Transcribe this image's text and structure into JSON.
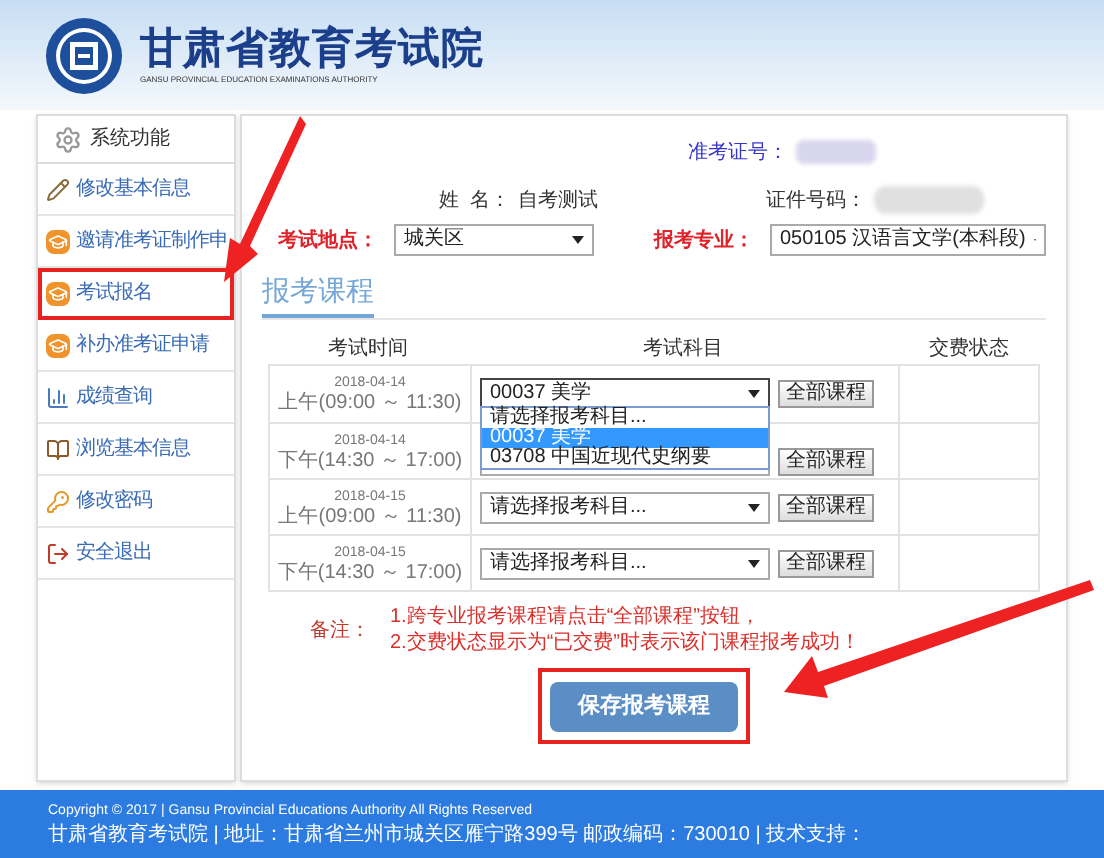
{
  "header": {
    "title": "甘肃省教育考试院",
    "subtitle": "GANSU PROVINCIAL EDUCATION EXAMINATIONS AUTHORITY"
  },
  "sidebar": {
    "title": "系统功能",
    "items": [
      {
        "label": "修改基本信息",
        "highlighted": false
      },
      {
        "label": "邀请准考证制作申",
        "highlighted": false
      },
      {
        "label": "考试报名",
        "highlighted": true
      },
      {
        "label": "补办准考证申请",
        "highlighted": false
      },
      {
        "label": "成绩查询",
        "highlighted": false
      },
      {
        "label": "浏览基本信息",
        "highlighted": false
      },
      {
        "label": "修改密码",
        "highlighted": false
      },
      {
        "label": "安全退出",
        "highlighted": false
      }
    ]
  },
  "ticket_label": "准考证号：",
  "name_label": "姓  名：",
  "name_value": "自考测试",
  "id_label": "证件号码：",
  "location": {
    "label": "考试地点：",
    "value": "城关区"
  },
  "major": {
    "label": "报考专业：",
    "value": "050105 汉语言文学(本科段)"
  },
  "section_title": "报考课程",
  "table": {
    "columns": [
      "考试时间",
      "考试科目",
      "交费状态"
    ],
    "rows": [
      {
        "date": "2018-04-14",
        "time": "上午(09:00 ～ 11:30)",
        "subject": "00037 美学",
        "button": "全部课程",
        "expanded": true,
        "options": [
          {
            "label": "请选择报考科目...",
            "selected": false
          },
          {
            "label": "00037 美学",
            "selected": true
          },
          {
            "label": "03708 中国近现代史纲要",
            "selected": false
          }
        ]
      },
      {
        "date": "2018-04-14",
        "time": "下午(14:30 ～ 17:00)",
        "subject": "",
        "button": "全部课程",
        "expanded": false
      },
      {
        "date": "2018-04-15",
        "time": "上午(09:00 ～ 11:30)",
        "subject": "请选择报考科目...",
        "button": "全部课程",
        "expanded": false
      },
      {
        "date": "2018-04-15",
        "time": "下午(14:30 ～ 17:00)",
        "subject": "请选择报考科目...",
        "button": "全部课程",
        "expanded": false
      }
    ]
  },
  "notes": {
    "label": "备注：",
    "lines": [
      "1.跨专业报考课程请点击“全部课程”按钮，",
      "2.交费状态显示为“已交费”时表示该门课程报考成功！"
    ]
  },
  "save_button": {
    "label": "保存报考课程",
    "highlighted": true
  },
  "footer": [
    "Copyright © 2017 | Gansu Provincial Educations Authority All Rights Reserved",
    "甘肃省教育考试院 | 地址：甘肃省兰州市城关区雁宁路399号 邮政编码：730010 | 技术支持："
  ]
}
